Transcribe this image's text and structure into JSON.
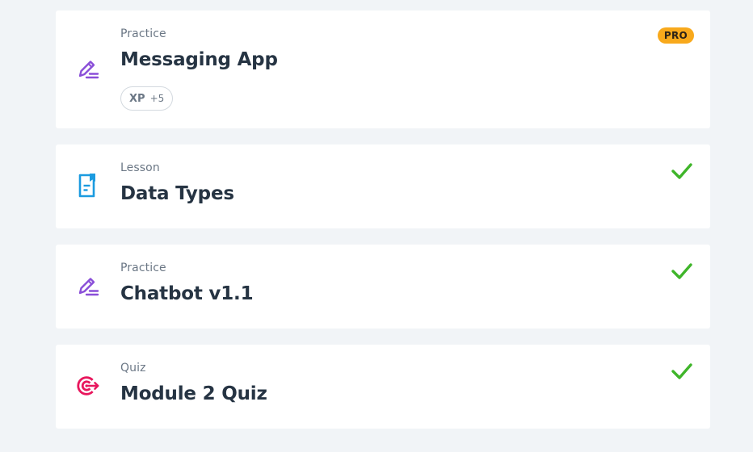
{
  "colors": {
    "background": "#f1f4f7",
    "card": "#ffffff",
    "practice_icon": "#8a4fd8",
    "lesson_icon": "#1b9be0",
    "quiz_icon": "#e8175d",
    "check": "#3fb52a",
    "pro_badge": "#f8a91c"
  },
  "items": [
    {
      "type": "Practice",
      "title": "Messaging App",
      "icon": "pencil-icon",
      "xp_label": "XP",
      "xp_value": "+5",
      "badge": "PRO",
      "completed": false
    },
    {
      "type": "Lesson",
      "title": "Data Types",
      "icon": "document-bookmark-icon",
      "completed": true
    },
    {
      "type": "Practice",
      "title": "Chatbot v1.1",
      "icon": "pencil-icon",
      "completed": true
    },
    {
      "type": "Quiz",
      "title": "Module 2 Quiz",
      "icon": "target-icon",
      "completed": true
    }
  ]
}
